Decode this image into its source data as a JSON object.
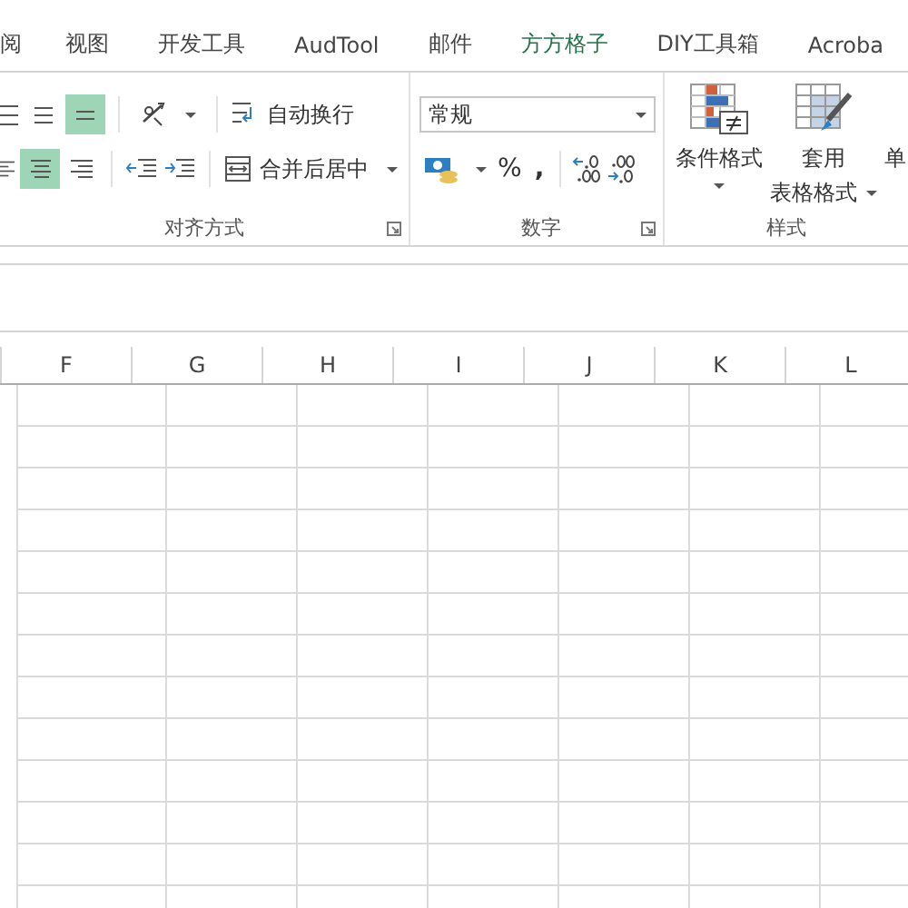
{
  "tabs": [
    {
      "label": "阅",
      "selected": false
    },
    {
      "label": "视图",
      "selected": false
    },
    {
      "label": "开发工具",
      "selected": false
    },
    {
      "label": "AudTool",
      "selected": false
    },
    {
      "label": "邮件",
      "selected": false
    },
    {
      "label": "方方格子",
      "selected": true
    },
    {
      "label": "DIY工具箱",
      "selected": false
    },
    {
      "label": "Acroba",
      "selected": false
    }
  ],
  "ribbon": {
    "alignment": {
      "vertical_align": [
        {
          "selected": false
        },
        {
          "selected": false
        },
        {
          "selected": true
        }
      ],
      "horizontal_align": [
        {
          "selected": false
        },
        {
          "selected": true
        },
        {
          "selected": false
        }
      ],
      "wrap_text": "自动换行",
      "merge": "合并后居中",
      "label": "对齐方式"
    },
    "number": {
      "format": "常规",
      "percent": "%",
      "comma": ",",
      "label": "数字"
    },
    "styles": {
      "conditional": "条件格式",
      "table_format": [
        "套用",
        "表格格式"
      ],
      "cell_styles": "单",
      "label": "样式"
    }
  },
  "columns": [
    "F",
    "G",
    "H",
    "I",
    "J",
    "K",
    "L"
  ]
}
